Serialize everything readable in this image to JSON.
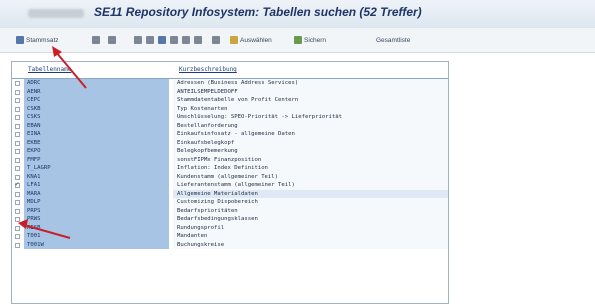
{
  "window": {
    "system_blur": "",
    "title": "SE11 Repository Infosystem: Tabellen suchen (52 Treffer)"
  },
  "toolbar": {
    "items": [
      {
        "label": "Stammsatz",
        "icon": "list-icon"
      },
      {
        "label": "",
        "icon": "move-icon"
      },
      {
        "label": "",
        "icon": "print-icon"
      },
      {
        "label": "",
        "icon": "filter-icon"
      },
      {
        "label": "",
        "icon": "table-icon"
      },
      {
        "label": "",
        "icon": "sort-icon"
      },
      {
        "label": "",
        "icon": "find-icon"
      },
      {
        "label": "Auswählen",
        "icon": "select-icon"
      },
      {
        "label": "Sichern",
        "icon": "save-icon"
      },
      {
        "label": "Gesamtliste",
        "icon": ""
      }
    ]
  },
  "table": {
    "columns": [
      "Tabellenname",
      "Kurzbeschreibung"
    ],
    "rows": [
      {
        "name": "ADRC",
        "desc": "Adressen (Business Address Services)"
      },
      {
        "name": "AENR",
        "desc": "ANTEILSEMPELDEDOFF"
      },
      {
        "name": "CEPC",
        "desc": "Stammdatentabelle von Profit Centern"
      },
      {
        "name": "CSKB",
        "desc": "Typ Kostenarten"
      },
      {
        "name": "CSKS",
        "desc": "Umschlüsselung: SPEO-Priorität -> Lieferpriorität"
      },
      {
        "name": "EBAN",
        "desc": "Bestellanforderung"
      },
      {
        "name": "EINA",
        "desc": "Einkaufsinfosatz - allgemeine Daten"
      },
      {
        "name": "EKBE",
        "desc": "Einkaufsbelegkopf"
      },
      {
        "name": "EKPO",
        "desc": "Belegkopfbemerkung"
      },
      {
        "name": "FMFP",
        "desc": "sonstFIPMx Finanzposition"
      },
      {
        "name": "T_LAGRP",
        "desc": "Inflation: Index Definition"
      },
      {
        "name": "KNA1",
        "desc": "Kundenstamm (allgemeiner Teil)"
      },
      {
        "name": "LFA1",
        "desc": "Lieferantenstamm (allgemeiner Teil)",
        "checked": true
      },
      {
        "name": "MARA",
        "desc": "Allgemeine Materialdaten",
        "selected": true
      },
      {
        "name": "MDLP",
        "desc": "Customizing Dispobereich"
      },
      {
        "name": "PRPS",
        "desc": "Bedarfsprioritäten"
      },
      {
        "name": "PRWS",
        "desc": "Bedarfsbedingungsklassen"
      },
      {
        "name": "RESB",
        "desc": "Rundungsprofil"
      },
      {
        "name": "T001",
        "desc": "Mandanten"
      },
      {
        "name": "T001W",
        "desc": "Buchungskreise"
      }
    ]
  },
  "colors": {
    "name_column_bg": "#a8c4e5",
    "arrow": "#c8202a"
  }
}
